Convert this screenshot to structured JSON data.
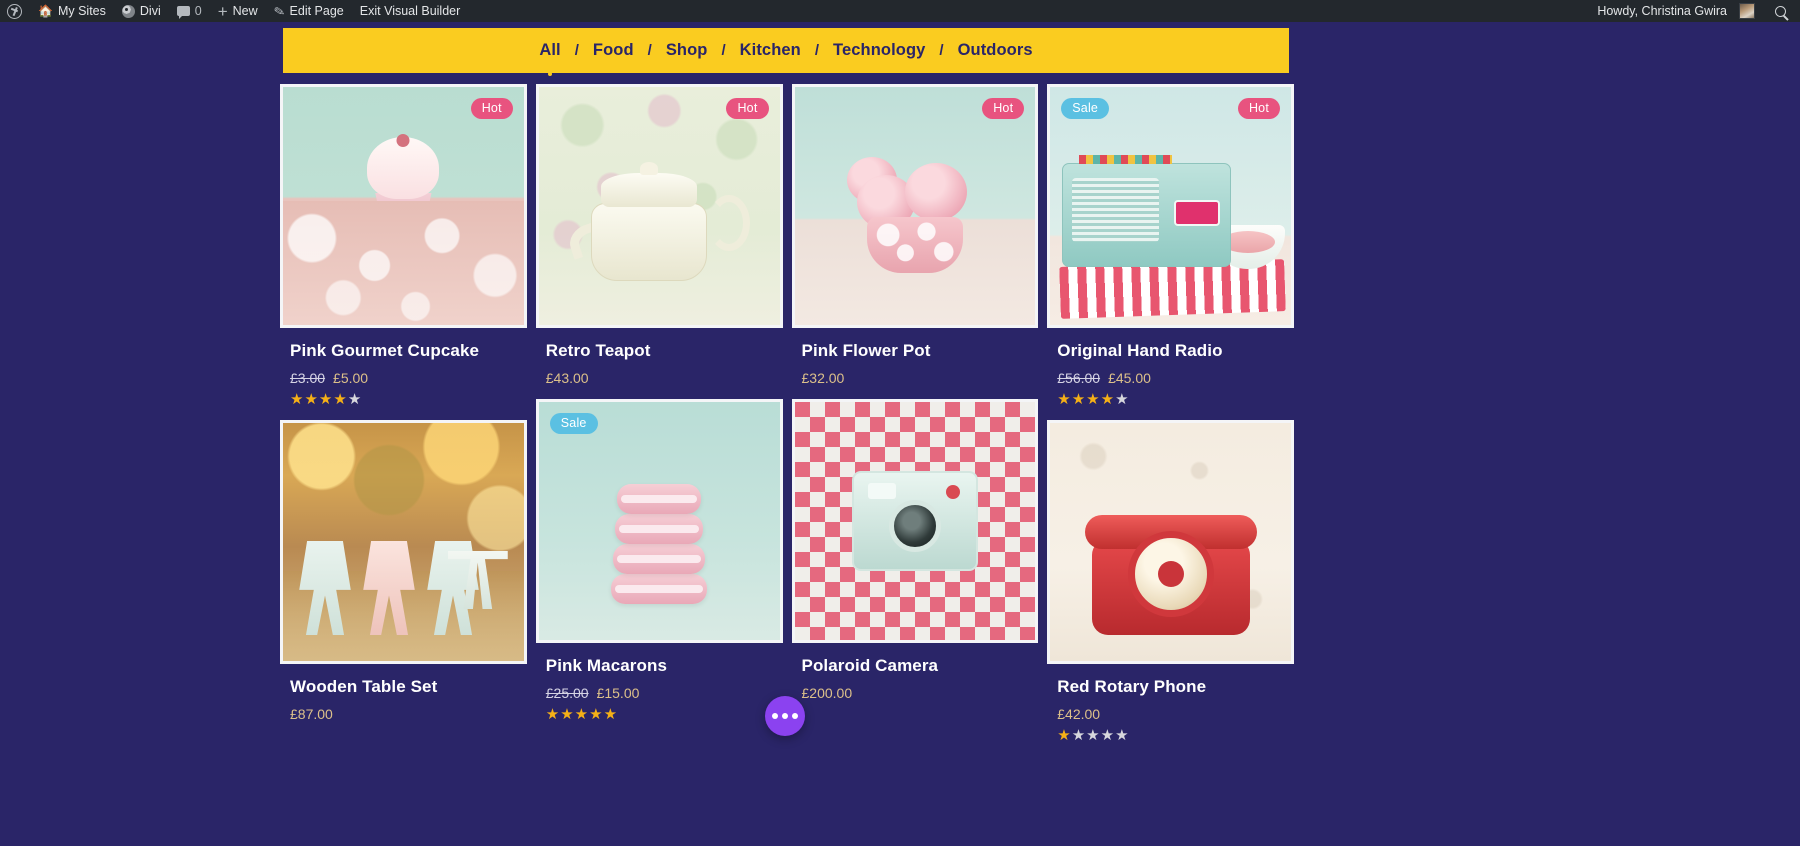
{
  "adminbar": {
    "wp_logo": "wordpress-logo",
    "items": [
      {
        "icon": "house-icon",
        "label": "My Sites"
      },
      {
        "icon": "divi-icon",
        "label": "Divi"
      },
      {
        "icon": "comment-icon",
        "label": "0"
      },
      {
        "icon": "plus-icon",
        "label": "New"
      },
      {
        "icon": "pencil-icon",
        "label": "Edit Page"
      },
      {
        "icon": "",
        "label": "Exit Visual Builder"
      }
    ],
    "greeting": "Howdy, Christina Gwira",
    "search_icon": "search-icon"
  },
  "filterbar": {
    "separator": "/",
    "tabs": [
      {
        "label": "All",
        "active": true
      },
      {
        "label": "Food",
        "active": false
      },
      {
        "label": "Shop",
        "active": false
      },
      {
        "label": "Kitchen",
        "active": false
      },
      {
        "label": "Technology",
        "active": false
      },
      {
        "label": "Outdoors",
        "active": false
      }
    ]
  },
  "colors": {
    "page_background": "#2a2568",
    "filterbar_background": "#facc20",
    "filterbar_text": "#2a2568",
    "badge_hot": "#e8537f",
    "badge_sale": "#5bc0e2",
    "price": "#dcc08a",
    "price_old": "#e4e2ef",
    "star_on": "#f5b017",
    "star_off": "#d7d7dd",
    "fab": "#8b42f0",
    "admin_bar": "#23282d"
  },
  "products": [
    {
      "name": "Pink Gourmet Cupcake",
      "badge": "Hot",
      "badge_type": "hot",
      "price_old": "£3.00",
      "price": "£5.00",
      "rating": 4,
      "rating_max": 5,
      "image": "pink-cupcake-on-plate"
    },
    {
      "name": "Retro Teapot",
      "badge": "Hot",
      "badge_type": "hot",
      "price_old": "",
      "price": "£43.00",
      "rating": 0,
      "rating_max": 5,
      "image": "cream-retro-teapot"
    },
    {
      "name": "Pink Flower Pot",
      "badge": "Hot",
      "badge_type": "hot",
      "price_old": "",
      "price": "£32.00",
      "rating": 0,
      "rating_max": 5,
      "image": "pink-roses-in-polka-dot-pot"
    },
    {
      "name": "Original Hand Radio",
      "badge": "Sale",
      "badge_type": "sale",
      "badge2": "Hot",
      "badge2_type": "hot",
      "price_old": "£56.00",
      "price": "£45.00",
      "rating": 4,
      "rating_max": 5,
      "image": "mint-vintage-radio"
    },
    {
      "name": "Wooden Table Set",
      "badge": "",
      "badge_type": "",
      "price_old": "",
      "price": "£87.00",
      "rating": 0,
      "rating_max": 5,
      "image": "outdoor-wooden-chairs-autumn"
    },
    {
      "name": "Pink Macarons",
      "badge": "Sale",
      "badge_type": "sale",
      "price_old": "£25.00",
      "price": "£15.00",
      "rating": 5,
      "rating_max": 5,
      "image": "stacked-pink-macarons"
    },
    {
      "name": "Polaroid Camera",
      "badge": "",
      "badge_type": "",
      "price_old": "",
      "price": "£200.00",
      "rating": 0,
      "rating_max": 5,
      "image": "mint-polaroid-camera-checkerboard"
    },
    {
      "name": "Red Rotary Phone",
      "badge": "",
      "badge_type": "",
      "price_old": "",
      "price": "£42.00",
      "rating": 1,
      "rating_max": 5,
      "image": "red-rotary-telephone"
    }
  ],
  "fab": {
    "icon": "ellipsis-icon",
    "label": "•••"
  }
}
